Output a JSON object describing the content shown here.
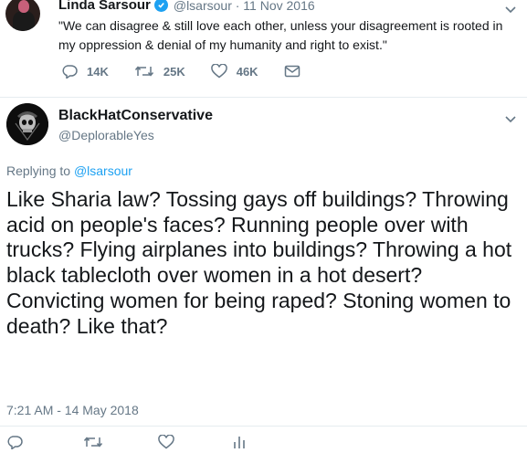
{
  "quoted": {
    "name": "Linda Sarsour",
    "handle_date": "@lsarsour · 11 Nov 2016",
    "text": "\"We can disagree & still love each other, unless your disagreement is rooted in my oppression & denial of my humanity and right to exist.\"",
    "replies": "14K",
    "retweets": "25K",
    "likes": "46K"
  },
  "tweet": {
    "name": "BlackHatConservative",
    "handle": "@DeplorableYes",
    "replying_prefix": "Replying to ",
    "replying_to": "@lsarsour",
    "text": "Like Sharia law? Tossing gays off buildings? Throwing acid on people's faces? Running people over with trucks? Flying airplanes into buildings? Throwing a hot black tablecloth over women in a hot desert? Convicting women for being raped? Stoning women to death? Like that?",
    "timestamp": "7:21 AM - 14 May 2018"
  },
  "colors": {
    "accent": "#1da1f2",
    "secondary_text": "#657786",
    "icon": "#657786"
  },
  "icons": [
    "verified-icon",
    "chevron-down-icon",
    "reply-icon",
    "retweet-icon",
    "like-icon",
    "message-icon",
    "analytics-icon"
  ]
}
